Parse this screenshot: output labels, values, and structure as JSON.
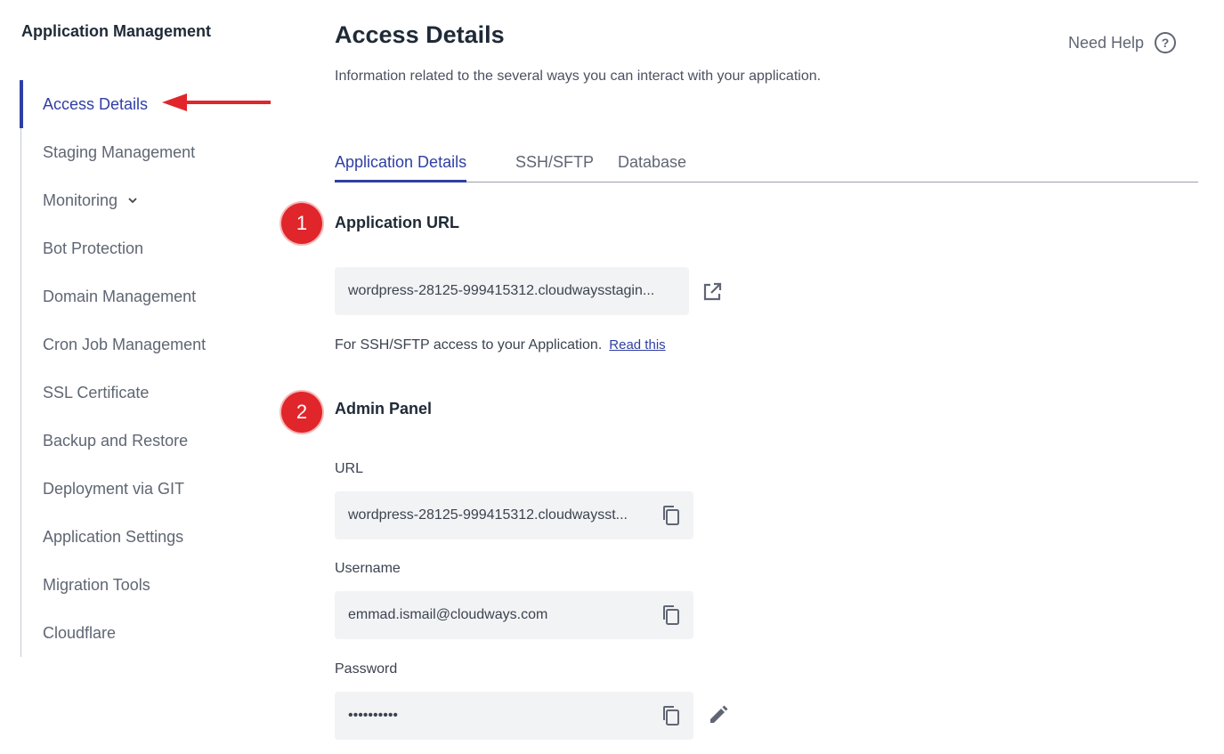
{
  "sidebar": {
    "title": "Application Management",
    "items": [
      {
        "label": "Access Details"
      },
      {
        "label": "Staging Management"
      },
      {
        "label": "Monitoring"
      },
      {
        "label": "Bot Protection"
      },
      {
        "label": "Domain Management"
      },
      {
        "label": "Cron Job Management"
      },
      {
        "label": "SSL Certificate"
      },
      {
        "label": "Backup and Restore"
      },
      {
        "label": "Deployment via GIT"
      },
      {
        "label": "Application Settings"
      },
      {
        "label": "Migration Tools"
      },
      {
        "label": "Cloudflare"
      }
    ],
    "active_item": "Access Details",
    "expand_icon": "chevron-down-icon"
  },
  "header": {
    "title": "Access Details",
    "subtitle": "Information related to the several ways you can interact with your application.",
    "help_label": "Need Help",
    "help_icon": "?"
  },
  "tabs": [
    {
      "label": "Application Details"
    },
    {
      "label": "SSH/SFTP"
    },
    {
      "label": "Database"
    }
  ],
  "active_tab": "Application Details",
  "annotations": {
    "badge_1": "1",
    "badge_2": "2",
    "arrow_color": "#e0262a"
  },
  "application_url": {
    "title": "Application URL",
    "value": "wordpress-28125-999415312.cloudwaysstagin...",
    "note": "For SSH/SFTP access to your Application.",
    "link_label": "Read this"
  },
  "admin_panel": {
    "title": "Admin Panel",
    "url_label": "URL",
    "url_value": "wordpress-28125-999415312.cloudwaysst...",
    "username_label": "Username",
    "username_value": "emmad.ismail@cloudways.com",
    "password_label": "Password",
    "password_value": "••••••••••"
  },
  "colors": {
    "accent": "#2f3fa4",
    "badge": "#e0262a",
    "field_bg": "#f2f3f5"
  }
}
